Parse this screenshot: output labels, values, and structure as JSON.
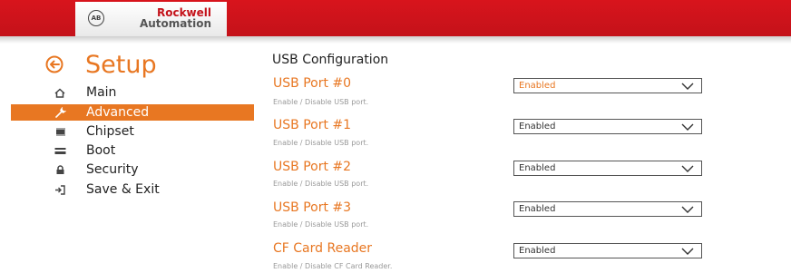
{
  "header": {
    "brand_line1": "Rockwell",
    "brand_line2": "Automation",
    "logo_mark": "AB"
  },
  "sidebar": {
    "title": "Setup",
    "items": [
      {
        "label": "Main",
        "icon": "home-icon"
      },
      {
        "label": "Advanced",
        "icon": "wrench-icon",
        "active": true
      },
      {
        "label": "Chipset",
        "icon": "chip-icon"
      },
      {
        "label": "Boot",
        "icon": "drive-icon"
      },
      {
        "label": "Security",
        "icon": "lock-icon"
      },
      {
        "label": "Save & Exit",
        "icon": "exit-icon"
      }
    ]
  },
  "main": {
    "section_title": "USB Configuration",
    "options": [
      {
        "label": "USB Port #0",
        "help": "Enable / Disable USB port.",
        "value": "Enabled",
        "focused": true
      },
      {
        "label": "USB Port #1",
        "help": "Enable / Disable USB port.",
        "value": "Enabled"
      },
      {
        "label": "USB Port #2",
        "help": "Enable / Disable USB port.",
        "value": "Enabled"
      },
      {
        "label": "USB Port #3",
        "help": "Enable / Disable USB port.",
        "value": "Enabled"
      },
      {
        "label": "CF Card Reader",
        "help": "Enable / Disable CF Card Reader.",
        "value": "Enabled"
      }
    ]
  },
  "colors": {
    "accent": "#e87722",
    "header_red": "#c4121a"
  }
}
